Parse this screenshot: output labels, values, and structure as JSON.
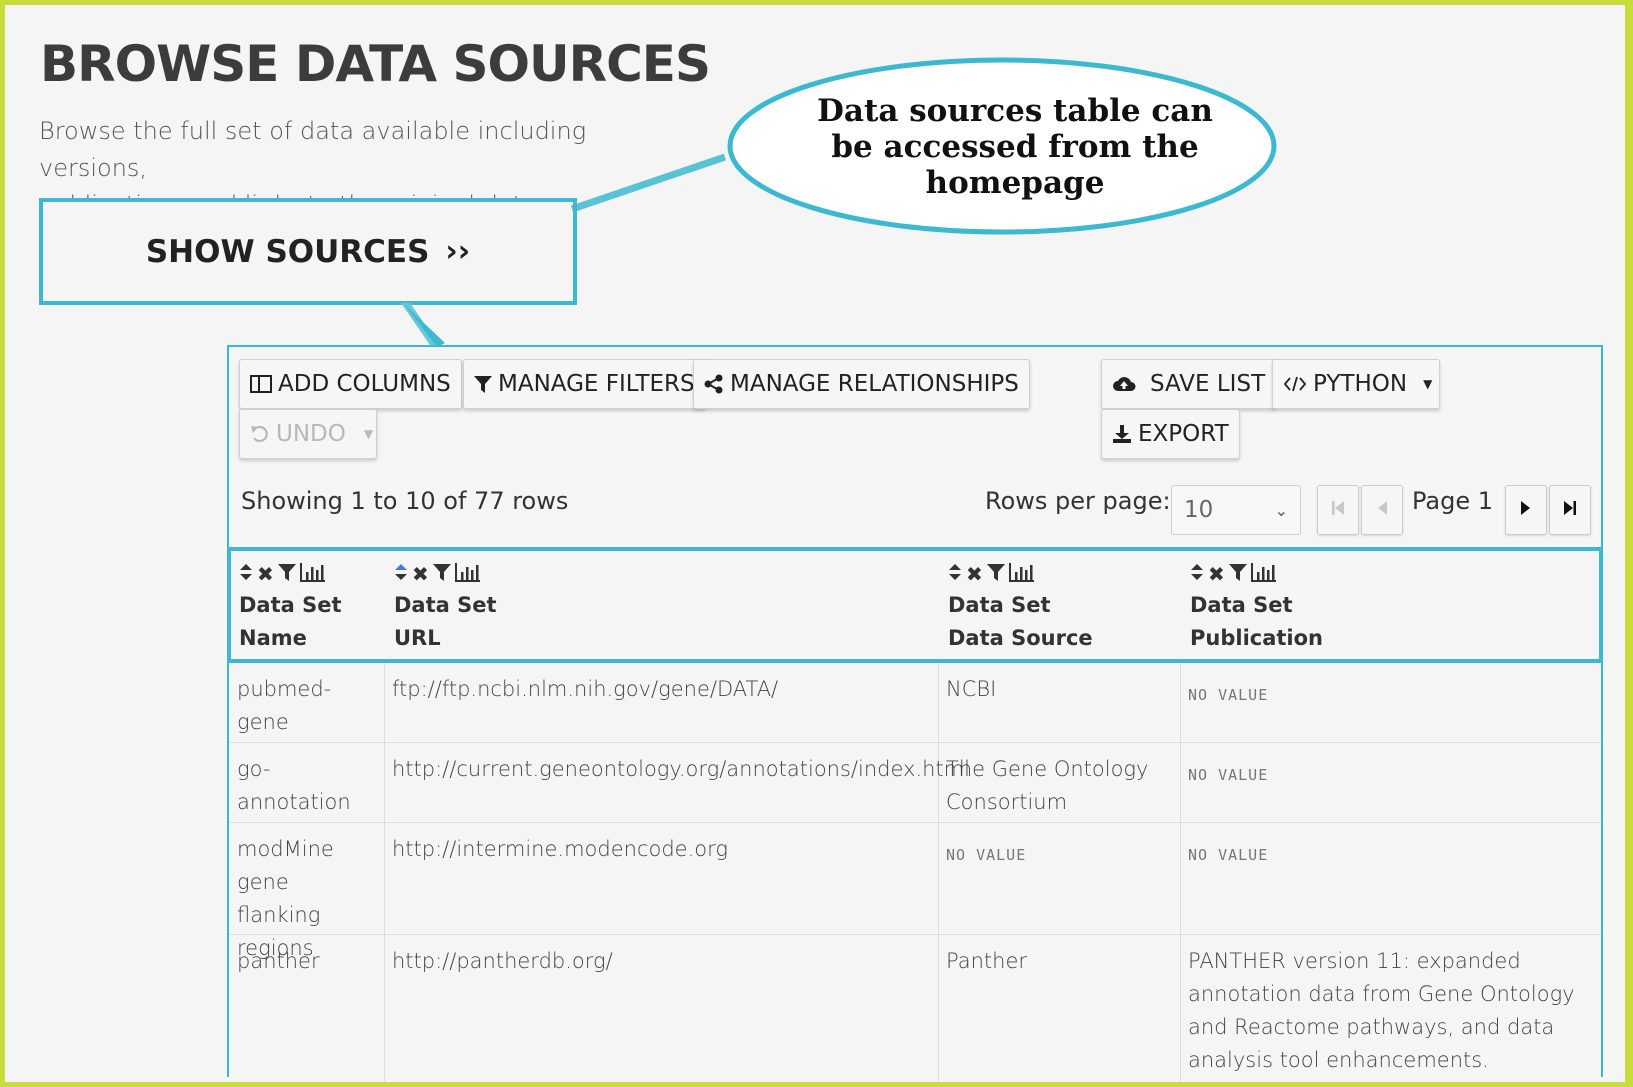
{
  "header": {
    "title": "BROWSE DATA SOURCES",
    "subtitle_line1": "Browse the full set of data available including versions,",
    "subtitle_line2": "publications and links to the original data.",
    "show_sources_label": "SHOW SOURCES"
  },
  "callout": {
    "line1": "Data sources table can",
    "line2": "be accessed from the",
    "line3": "homepage"
  },
  "toolbar": {
    "add_columns": "ADD COLUMNS",
    "manage_filters": "MANAGE FILTERS",
    "manage_relationships": "MANAGE RELATIONSHIPS",
    "save_list": "SAVE LIST",
    "python": "PYTHON",
    "undo": "UNDO",
    "export": "EXPORT"
  },
  "pagination": {
    "showing": "Showing 1 to 10 of 77 rows",
    "rows_per_page_label": "Rows per page:",
    "rows_per_page_value": "10",
    "page_label": "Page 1"
  },
  "table": {
    "columns": [
      {
        "line1": "Data Set",
        "line2": "Name"
      },
      {
        "line1": "Data Set",
        "line2": "URL"
      },
      {
        "line1": "Data Set",
        "line2": "Data Source"
      },
      {
        "line1": "Data Set",
        "line2": "Publication"
      }
    ],
    "no_value": "NO VALUE",
    "rows": [
      {
        "name": [
          "pubmed-",
          "gene"
        ],
        "url": "ftp://ftp.ncbi.nlm.nih.gov/gene/DATA/",
        "source": [
          "NCBI"
        ],
        "publication": []
      },
      {
        "name": [
          "go-annotation"
        ],
        "url": "http://current.geneontology.org/annotations/index.html",
        "source": [
          "The Gene Ontology",
          "Consortium"
        ],
        "publication": []
      },
      {
        "name": [
          "modMine",
          "gene flanking",
          "regions"
        ],
        "url": "http://intermine.modencode.org",
        "source": [],
        "publication": []
      },
      {
        "name": [
          "panther"
        ],
        "url": "http://pantherdb.org/",
        "source": [
          "Panther"
        ],
        "publication": [
          "PANTHER version 11: expanded",
          "annotation data from Gene Ontology",
          "and Reactome pathways, and data",
          "analysis tool enhancements."
        ]
      }
    ]
  },
  "colors": {
    "accent": "#3db9cf",
    "border": "#c8dc3c",
    "background": "#f5f5f5"
  }
}
